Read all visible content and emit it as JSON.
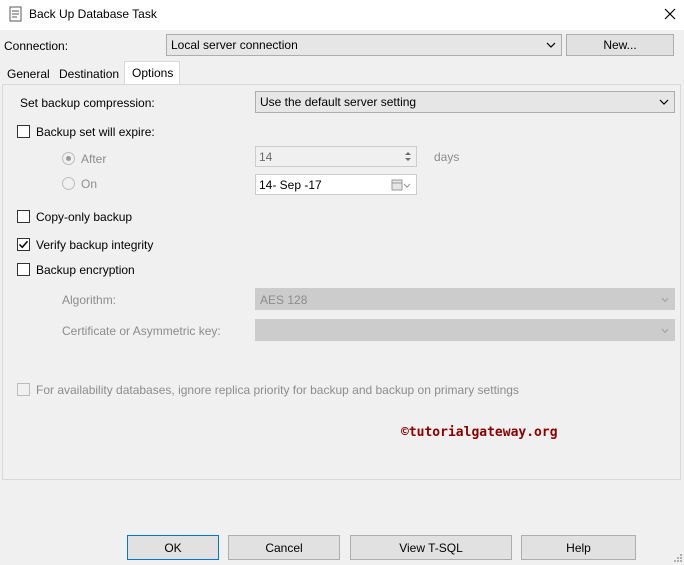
{
  "window": {
    "title": "Back Up Database Task"
  },
  "connection": {
    "label": "Connection:",
    "value": "Local server connection",
    "new_button": "New..."
  },
  "tabs": [
    {
      "label": "General",
      "active": false
    },
    {
      "label": "Destination",
      "active": false
    },
    {
      "label": "Options",
      "active": true
    }
  ],
  "options": {
    "compression": {
      "label": "Set backup compression:",
      "value": "Use the default server setting"
    },
    "expire": {
      "label": "Backup set will expire:",
      "checked": false,
      "after_label": "After",
      "after_value": "14",
      "after_unit": "days",
      "on_label": "On",
      "on_value": "14- Sep -17"
    },
    "copy_only": {
      "label": "Copy-only backup",
      "checked": false
    },
    "verify": {
      "label": "Verify backup integrity",
      "checked": true
    },
    "encryption": {
      "label": "Backup encryption",
      "checked": false,
      "algorithm_label": "Algorithm:",
      "algorithm_value": "AES 128",
      "cert_label": "Certificate or Asymmetric key:",
      "cert_value": ""
    },
    "availability": {
      "label": "For availability databases, ignore replica priority for backup and backup on primary settings",
      "checked": false
    }
  },
  "watermark": "©tutorialgateway.org",
  "buttons": {
    "ok": "OK",
    "cancel": "Cancel",
    "view_tsql": "View T-SQL",
    "help": "Help"
  },
  "colors": {
    "accent": "#0078d7",
    "watermark": "#8b0000",
    "disabled_text": "#8c8c8c"
  }
}
